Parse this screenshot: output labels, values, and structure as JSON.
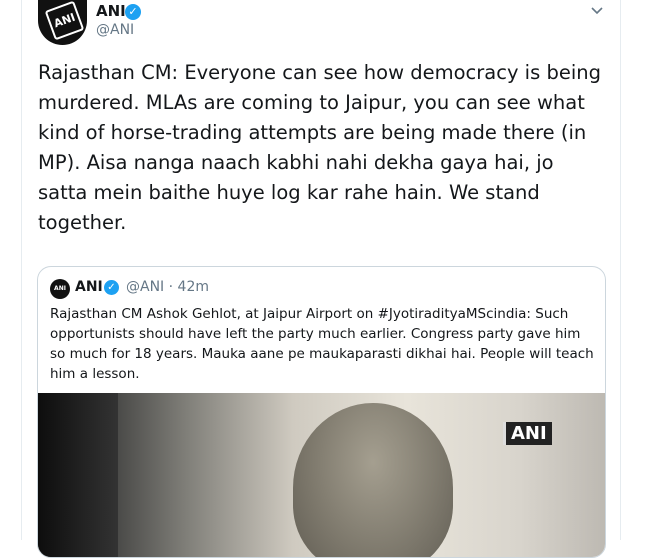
{
  "tweet": {
    "author_name": "ANI",
    "author_handle": "@ANI",
    "avatar_text": "ANI",
    "text": "Rajasthan CM: Everyone can see how democracy is being murdered. MLAs are coming to Jaipur, you can see what kind of horse-trading attempts are being made there (in MP). Aisa nanga naach kabhi nahi dekha gaya hai, jo satta mein baithe huye log kar rahe hain. We stand together."
  },
  "quoted": {
    "author_name": "ANI",
    "author_handle": "@ANI",
    "separator": "·",
    "time": "42m",
    "text": "Rajasthan CM Ashok Gehlot, at Jaipur Airport on #JyotiradityaMScindia: Such opportunists should have left the party much earlier. Congress party gave him so much for 18 years. Mauka aane pe maukaparasti dikhai hai. People will teach him a lesson.",
    "media_watermark": "ANI"
  },
  "icons": {
    "verified": "verified-badge-icon",
    "menu": "chevron-down-icon"
  },
  "colors": {
    "accent": "#1da1f2",
    "secondary_text": "#657786",
    "border": "#ccd6dd"
  }
}
